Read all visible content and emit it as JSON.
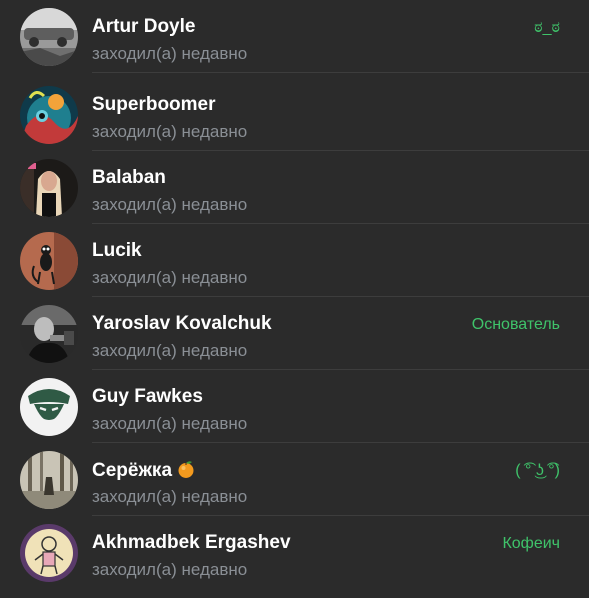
{
  "members": [
    {
      "name": "Artur Doyle",
      "status": "заходил(а) недавно",
      "badge": "ಠ_ಠ",
      "avatar_icon": "photo-car-icon"
    },
    {
      "name": "Superboomer",
      "status": "заходил(а) недавно",
      "badge": "",
      "avatar_icon": "psychedelic-art-icon"
    },
    {
      "name": "Balaban",
      "status": "заходил(а) недавно",
      "badge": "",
      "avatar_icon": "person-photo-icon"
    },
    {
      "name": "Lucik",
      "status": "заходил(а) недавно",
      "badge": "",
      "avatar_icon": "cartoon-character-icon"
    },
    {
      "name": "Yaroslav Kovalchuk",
      "status": "заходил(а) недавно",
      "badge": "Основатель",
      "avatar_icon": "bw-portrait-icon"
    },
    {
      "name": "Guy Fawkes",
      "status": "заходил(а) недавно",
      "badge": "",
      "avatar_icon": "guy-fawkes-mask-icon"
    },
    {
      "name": "Серёжка",
      "status": "заходил(а) недавно",
      "badge": "( ͡° ͜ʖ ͡°)",
      "avatar_icon": "forest-scene-icon",
      "name_emoji": "tangerine-emoji"
    },
    {
      "name": "Akhmadbek Ergashev",
      "status": "заходил(а) недавно",
      "badge": "Кофеич",
      "avatar_icon": "cartoon-drawing-icon"
    }
  ],
  "colors": {
    "background": "#2b2b2b",
    "name_text": "#ffffff",
    "status_text": "#8a8f95",
    "badge_text": "#3fc36a",
    "divider": "#3d3d3d"
  }
}
